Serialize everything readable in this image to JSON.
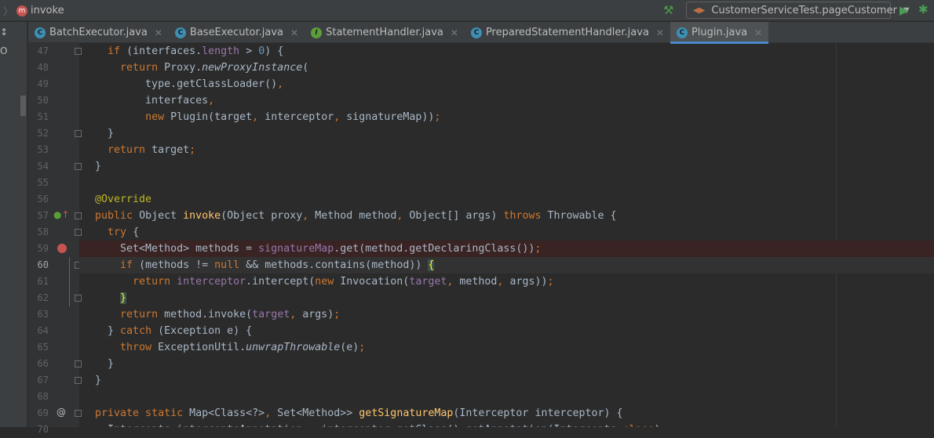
{
  "breadcrumb": {
    "method_badge": "m",
    "label": "invoke"
  },
  "toolbar": {
    "run_config": "CustomerServiceTest.pageCustomer",
    "build_icon": "hammer-icon",
    "run_icon": "play-icon",
    "debug_icon": "bug-icon"
  },
  "left_strip": {
    "t1": "↕",
    "t2": "O"
  },
  "tabs": [
    {
      "label": "BatchExecutor.java",
      "icon": "C",
      "kind": "c"
    },
    {
      "label": "BaseExecutor.java",
      "icon": "C",
      "kind": "c"
    },
    {
      "label": "StatementHandler.java",
      "icon": "I",
      "kind": "i"
    },
    {
      "label": "PreparedStatementHandler.java",
      "icon": "C",
      "kind": "c"
    },
    {
      "label": "Plugin.java",
      "icon": "C",
      "kind": "c",
      "active": true
    }
  ],
  "code": {
    "lines": [
      {
        "n": "47",
        "fold": true,
        "t": [
          [
            "    ",
            "d"
          ],
          [
            "if ",
            "k"
          ],
          [
            "(interfaces.",
            "d"
          ],
          [
            "length",
            "f"
          ],
          [
            " > ",
            "d"
          ],
          [
            "0",
            "n"
          ],
          [
            ") {",
            "d"
          ]
        ]
      },
      {
        "n": "48",
        "t": [
          [
            "      ",
            "d"
          ],
          [
            "return ",
            "k"
          ],
          [
            "Proxy.",
            "d"
          ],
          [
            "newProxyInstance",
            "i"
          ],
          [
            "(",
            "d"
          ]
        ]
      },
      {
        "n": "49",
        "t": [
          [
            "          type.getClassLoader()",
            "d"
          ],
          [
            ",",
            "k"
          ]
        ]
      },
      {
        "n": "50",
        "t": [
          [
            "          interfaces",
            "d"
          ],
          [
            ",",
            "k"
          ]
        ]
      },
      {
        "n": "51",
        "t": [
          [
            "          ",
            "d"
          ],
          [
            "new ",
            "k"
          ],
          [
            "Plugin(target",
            "d"
          ],
          [
            ", ",
            "k"
          ],
          [
            "interceptor",
            "d"
          ],
          [
            ", ",
            "k"
          ],
          [
            "signatureMap))",
            "d"
          ],
          [
            ";",
            "k"
          ]
        ]
      },
      {
        "n": "52",
        "fold": true,
        "t": [
          [
            "    }",
            "d"
          ]
        ]
      },
      {
        "n": "53",
        "t": [
          [
            "    ",
            "d"
          ],
          [
            "return ",
            "k"
          ],
          [
            "target",
            "d"
          ],
          [
            ";",
            "k"
          ]
        ]
      },
      {
        "n": "54",
        "fold": true,
        "t": [
          [
            "  }",
            "d"
          ]
        ]
      },
      {
        "n": "55",
        "t": []
      },
      {
        "n": "56",
        "t": [
          [
            "  ",
            "d"
          ],
          [
            "@Override",
            "a"
          ]
        ]
      },
      {
        "n": "57",
        "fold": true,
        "mark": "override",
        "t": [
          [
            "  ",
            "d"
          ],
          [
            "public ",
            "k"
          ],
          [
            "Object ",
            "d"
          ],
          [
            "invoke",
            "m"
          ],
          [
            "(Object proxy",
            "d"
          ],
          [
            ", ",
            "k"
          ],
          [
            "Method method",
            "d"
          ],
          [
            ", ",
            "k"
          ],
          [
            "Object[] args) ",
            "d"
          ],
          [
            "throws ",
            "k"
          ],
          [
            "Throwable {",
            "d"
          ]
        ]
      },
      {
        "n": "58",
        "fold": true,
        "t": [
          [
            "    ",
            "d"
          ],
          [
            "try ",
            "k"
          ],
          [
            "{",
            "d"
          ]
        ]
      },
      {
        "n": "59",
        "bp": true,
        "t": [
          [
            "      Set<Method> methods = ",
            "d"
          ],
          [
            "signatureMap",
            "f"
          ],
          [
            ".get(method.getDeclaringClass())",
            "d"
          ],
          [
            ";",
            "k"
          ]
        ]
      },
      {
        "n": "60",
        "fold": true,
        "cur": true,
        "t": [
          [
            "      ",
            "d"
          ],
          [
            "if ",
            "k"
          ],
          [
            "(methods != ",
            "d"
          ],
          [
            "null ",
            "k"
          ],
          [
            "&& methods.contains(method)) ",
            "d"
          ],
          [
            "{",
            "br"
          ]
        ]
      },
      {
        "n": "61",
        "t": [
          [
            "        ",
            "d"
          ],
          [
            "return ",
            "k"
          ],
          [
            "interceptor",
            "f"
          ],
          [
            ".intercept(",
            "d"
          ],
          [
            "new ",
            "k"
          ],
          [
            "Invocation(",
            "d"
          ],
          [
            "target",
            "f"
          ],
          [
            ", ",
            "k"
          ],
          [
            "method",
            "d"
          ],
          [
            ", ",
            "k"
          ],
          [
            "args))",
            "d"
          ],
          [
            ";",
            "k"
          ]
        ]
      },
      {
        "n": "62",
        "fold": true,
        "t": [
          [
            "      ",
            "d"
          ],
          [
            "}",
            "br"
          ]
        ]
      },
      {
        "n": "63",
        "t": [
          [
            "      ",
            "d"
          ],
          [
            "return ",
            "k"
          ],
          [
            "method.invoke(",
            "d"
          ],
          [
            "target",
            "f"
          ],
          [
            ", ",
            "k"
          ],
          [
            "args)",
            "d"
          ],
          [
            ";",
            "k"
          ]
        ]
      },
      {
        "n": "64",
        "t": [
          [
            "    } ",
            "d"
          ],
          [
            "catch ",
            "k"
          ],
          [
            "(Exception e) {",
            "d"
          ]
        ]
      },
      {
        "n": "65",
        "t": [
          [
            "      ",
            "d"
          ],
          [
            "throw ",
            "k"
          ],
          [
            "ExceptionUtil.",
            "d"
          ],
          [
            "unwrapThrowable",
            "i"
          ],
          [
            "(e)",
            "d"
          ],
          [
            ";",
            "k"
          ]
        ]
      },
      {
        "n": "66",
        "fold": true,
        "t": [
          [
            "    }",
            "d"
          ]
        ]
      },
      {
        "n": "67",
        "fold": true,
        "t": [
          [
            "  }",
            "d"
          ]
        ]
      },
      {
        "n": "68",
        "t": []
      },
      {
        "n": "69",
        "fold": true,
        "mark": "at",
        "t": [
          [
            "  ",
            "d"
          ],
          [
            "private static ",
            "k"
          ],
          [
            "Map<Class<?>",
            "d"
          ],
          [
            ", ",
            "k"
          ],
          [
            "Set<Method>> ",
            "d"
          ],
          [
            "getSignatureMap",
            "m"
          ],
          [
            "(Interceptor interceptor) {",
            "d"
          ]
        ]
      },
      {
        "n": "70",
        "t": [
          [
            "    Intercepts interceptsAnnotation = interceptor.getClass().getAnnotation(Intercepts.",
            "d"
          ],
          [
            "class",
            "k"
          ],
          [
            ")",
            "d"
          ],
          [
            ";",
            "k"
          ]
        ]
      }
    ]
  }
}
